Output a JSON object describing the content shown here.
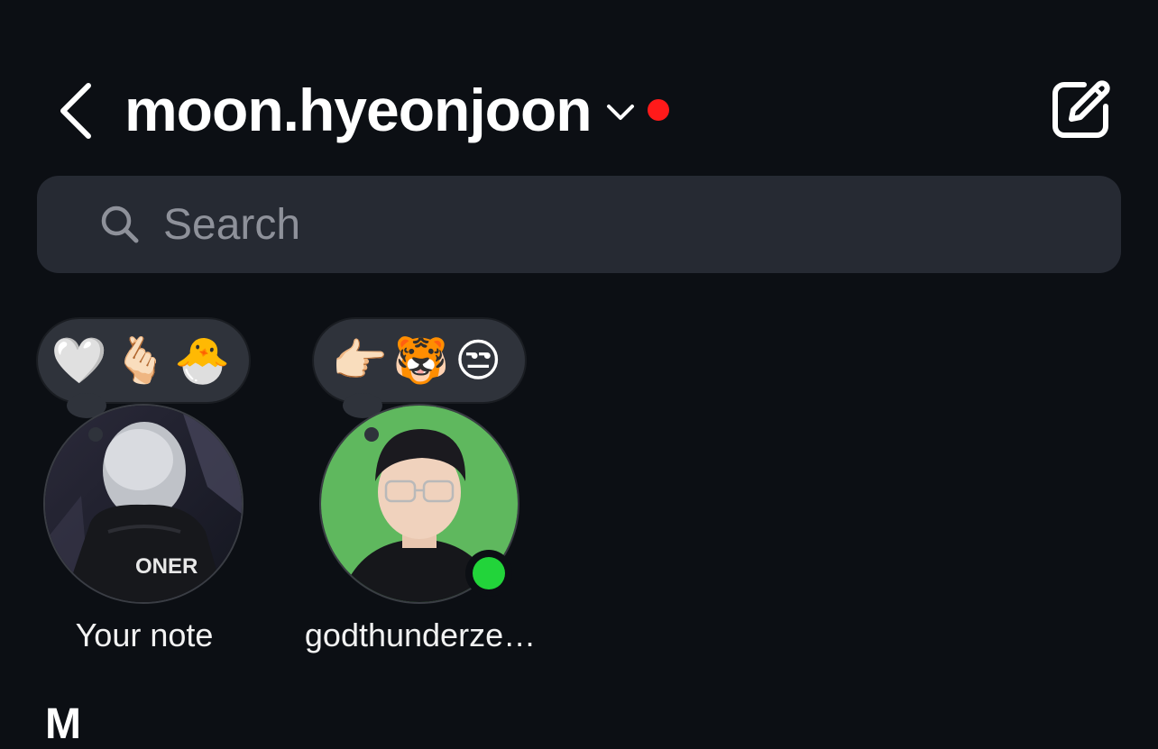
{
  "header": {
    "username": "moon.hyeonjoon",
    "notification_color": "#ff1a1a"
  },
  "search": {
    "placeholder": "Search",
    "value": ""
  },
  "notes": [
    {
      "note_text": "🤍🫰🏻🐣",
      "label": "Your note",
      "online": false
    },
    {
      "note_text": "👉🏻🐯😒",
      "label": "godthunderze…",
      "online": true
    }
  ],
  "status_colors": {
    "online": "#22d43a"
  },
  "messages_heading": "M",
  "icons": {
    "back": "chevron-left-icon",
    "account_switch": "chevron-down-icon",
    "compose": "compose-icon",
    "search": "search-icon"
  }
}
